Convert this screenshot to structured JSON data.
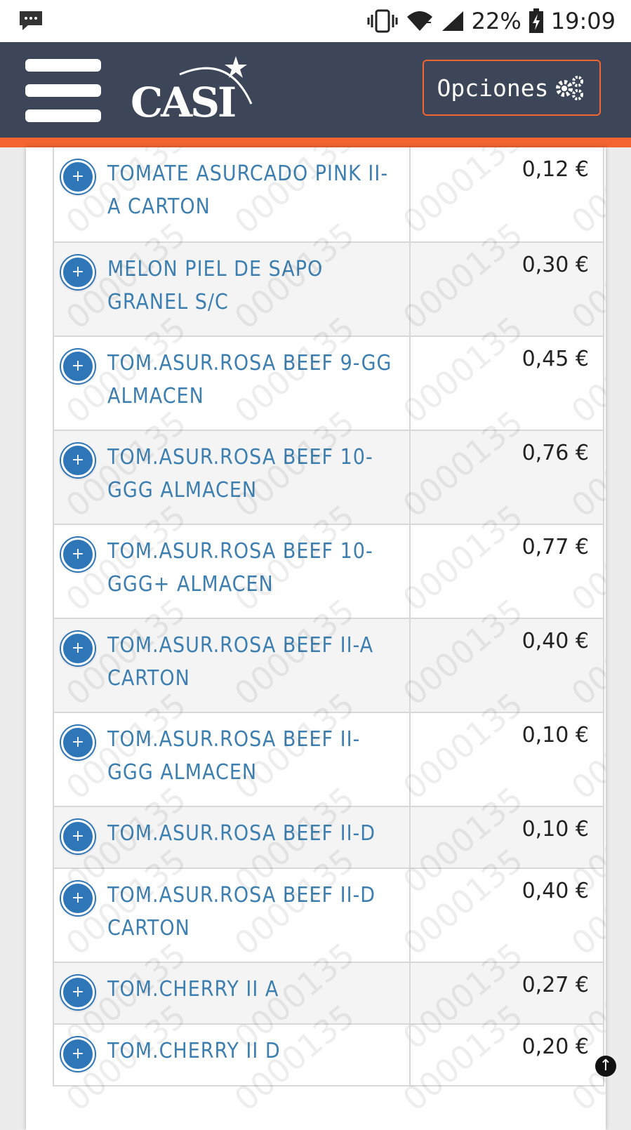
{
  "status_bar": {
    "battery": "22%",
    "time": "19:09"
  },
  "header": {
    "logo": "CASI",
    "options_label": "Opciones"
  },
  "products": [
    {
      "name": "TOMATE ASURCADO PINK II-A CARTON",
      "price": "0,12 €"
    },
    {
      "name": "MELON PIEL DE SAPO GRANEL S/C",
      "price": "0,30 €"
    },
    {
      "name": "TOM.ASUR.ROSA BEEF 9-GG ALMACEN",
      "price": "0,45 €"
    },
    {
      "name": "TOM.ASUR.ROSA BEEF 10-GGG ALMACEN",
      "price": "0,76 €"
    },
    {
      "name": "TOM.ASUR.ROSA BEEF 10-GGG+ ALMACEN",
      "price": "0,77 €"
    },
    {
      "name": "TOM.ASUR.ROSA BEEF II-A CARTON",
      "price": "0,40 €"
    },
    {
      "name": "TOM.ASUR.ROSA BEEF II-GGG ALMACEN",
      "price": "0,10 €"
    },
    {
      "name": "TOM.ASUR.ROSA BEEF II-D",
      "price": "0,10 €"
    },
    {
      "name": "TOM.ASUR.ROSA BEEF II-D CARTON",
      "price": "0,40 €"
    },
    {
      "name": "TOM.CHERRY II A",
      "price": "0,27 €"
    },
    {
      "name": "TOM.CHERRY II D",
      "price": "0,20 €"
    }
  ],
  "watermark": "0000135",
  "colors": {
    "header_bg": "#3c4658",
    "accent": "#f26430",
    "link": "#3d7fb0",
    "plus_button": "#2e76b8"
  }
}
